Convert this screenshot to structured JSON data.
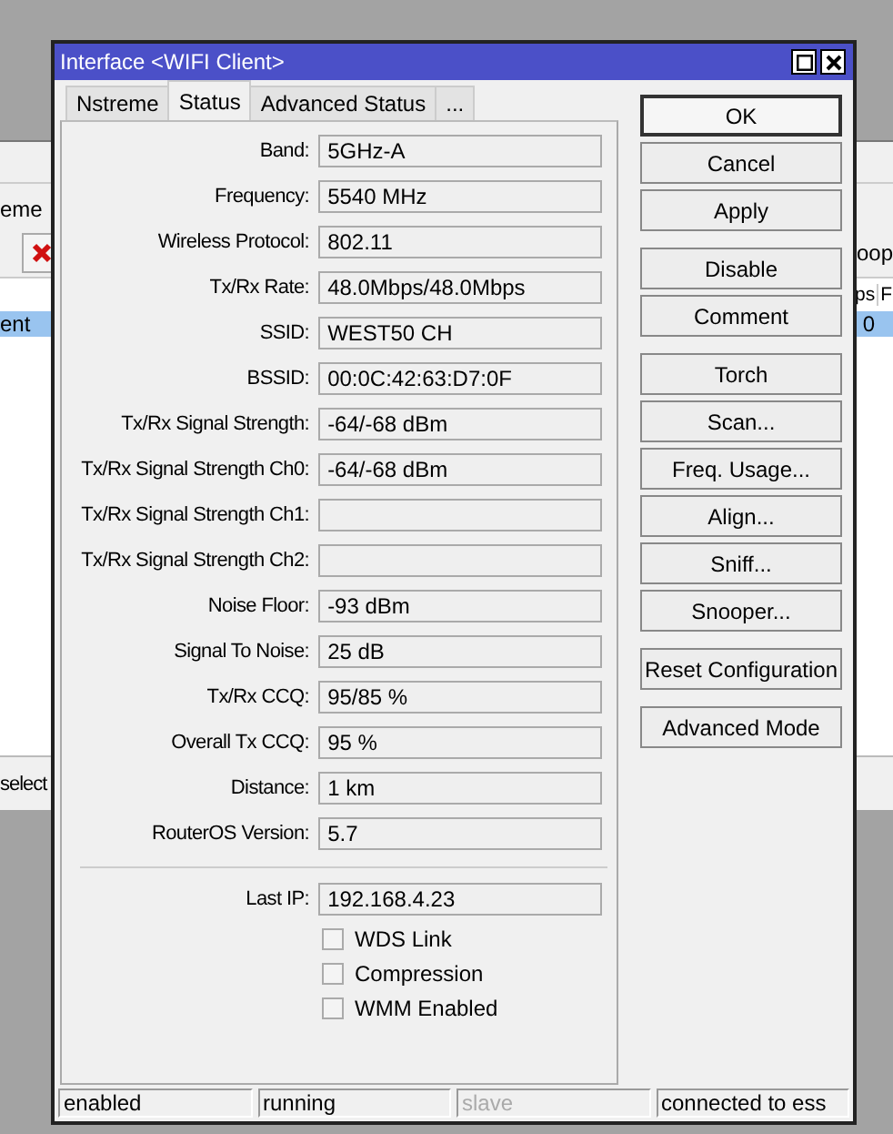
{
  "background": {
    "tab_text": "eme",
    "row_text": "ent",
    "status_text": "select",
    "toolbar_right_text": "oop",
    "column_headers_right": [
      "ps",
      "F"
    ],
    "row_right_text": "0"
  },
  "window": {
    "title": "Interface <WIFI Client>"
  },
  "tabs": [
    {
      "label": "Nstreme",
      "selected": false
    },
    {
      "label": "Status",
      "selected": true
    },
    {
      "label": "Advanced Status",
      "selected": false
    },
    {
      "label": "...",
      "selected": false
    }
  ],
  "fields": [
    {
      "label": "Band:",
      "value": "5GHz-A"
    },
    {
      "label": "Frequency:",
      "value": "5540 MHz"
    },
    {
      "label": "Wireless Protocol:",
      "value": "802.11"
    },
    {
      "label": "Tx/Rx Rate:",
      "value": "48.0Mbps/48.0Mbps"
    },
    {
      "label": "SSID:",
      "value": "WEST50 CH"
    },
    {
      "label": "BSSID:",
      "value": "00:0C:42:63:D7:0F"
    },
    {
      "label": "Tx/Rx Signal Strength:",
      "value": "-64/-68 dBm"
    },
    {
      "label": "Tx/Rx Signal Strength Ch0:",
      "value": "-64/-68 dBm"
    },
    {
      "label": "Tx/Rx Signal Strength Ch1:"
    },
    {
      "label": "Tx/Rx Signal Strength Ch2:"
    },
    {
      "label": "Noise Floor:",
      "value": "-93 dBm"
    },
    {
      "label": "Signal To Noise:",
      "value": "25 dB"
    },
    {
      "label": "Tx/Rx CCQ:",
      "value": "95/85 %"
    },
    {
      "label": "Overall Tx CCQ:",
      "value": "95 %"
    },
    {
      "label": "Distance:",
      "value": "1 km"
    },
    {
      "label": "RouterOS Version:",
      "value": "5.7"
    }
  ],
  "last_ip": {
    "label": "Last IP:",
    "value": "192.168.4.23"
  },
  "checkboxes": [
    {
      "label": "WDS Link",
      "checked": false
    },
    {
      "label": "Compression",
      "checked": false
    },
    {
      "label": "WMM Enabled",
      "checked": false
    }
  ],
  "buttons": [
    {
      "label": "OK",
      "default": true
    },
    {
      "label": "Cancel",
      "default": false
    },
    {
      "label": "Apply",
      "default": false
    },
    {
      "label": "Disable",
      "default": false
    },
    {
      "label": "Comment",
      "default": false
    },
    {
      "label": "Torch",
      "default": false
    },
    {
      "label": "Scan...",
      "default": false
    },
    {
      "label": "Freq. Usage...",
      "default": false
    },
    {
      "label": "Align...",
      "default": false
    },
    {
      "label": "Sniff...",
      "default": false
    },
    {
      "label": "Snooper...",
      "default": false
    },
    {
      "label": "Reset Configuration",
      "default": false
    },
    {
      "label": "Advanced Mode",
      "default": false
    }
  ],
  "status_bar": [
    {
      "text": "enabled",
      "disabled": false
    },
    {
      "text": "running",
      "disabled": false
    },
    {
      "text": "slave",
      "disabled": true
    },
    {
      "text": "connected to ess",
      "disabled": false
    }
  ]
}
